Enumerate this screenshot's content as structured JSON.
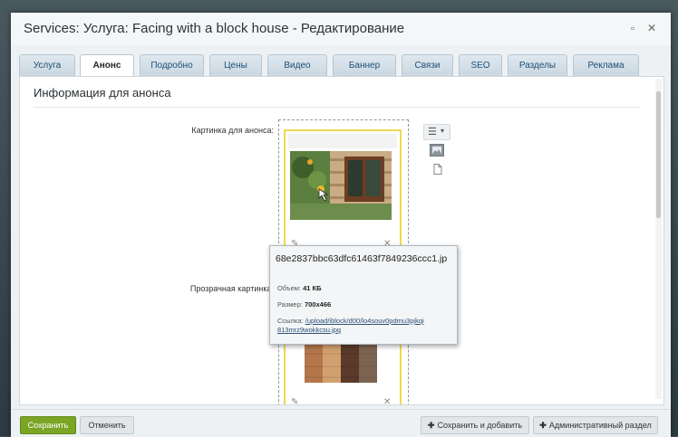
{
  "window": {
    "title": "Services: Услуга: Facing with a block house - Редактирование",
    "maximize_glyph": "▫",
    "close_glyph": "✕"
  },
  "tabs": [
    {
      "label": "Услуга",
      "active": false
    },
    {
      "label": "Анонс",
      "active": true
    },
    {
      "label": "Подробно",
      "active": false
    },
    {
      "label": "Цены",
      "active": false
    },
    {
      "label": "Видео",
      "active": false
    },
    {
      "label": "Баннер",
      "active": false
    },
    {
      "label": "Связи",
      "active": false
    },
    {
      "label": "SEO",
      "active": false
    },
    {
      "label": "Разделы",
      "active": false
    },
    {
      "label": "Реклама",
      "active": false
    }
  ],
  "section": {
    "title": "Информация для анонса"
  },
  "fields": {
    "preview_image_label": "Картинка для анонса:",
    "transparent_image_label": "Прозрачная картинка:"
  },
  "tooltip": {
    "filename": "68e2837bbc63dfc61463f7849236ccc1.jp",
    "size_label": "Объем:",
    "size_value": "41 КБ",
    "dimensions_label": "Размер:",
    "dimensions_value": "700x466",
    "link_label": "Ссылка:",
    "link_line1": "/upload/iblock/d00/lo4souv0pdmu3pjkqi",
    "link_line2": "813mrz9wokkcsu.jpg"
  },
  "icons": {
    "menu": "☰",
    "dropdown": "▾",
    "edit": "✎",
    "remove": "✕"
  },
  "footer": {
    "save_label": "Сохранить",
    "cancel_label": "Отменить",
    "save_add_label": "Сохранить и добавить",
    "admin_label": "Административный раздел",
    "plus_glyph": "✚"
  },
  "colors": {
    "accent_green": "#7ba524",
    "tab_text": "#1d4f77",
    "card_border": "#f1d84f"
  }
}
